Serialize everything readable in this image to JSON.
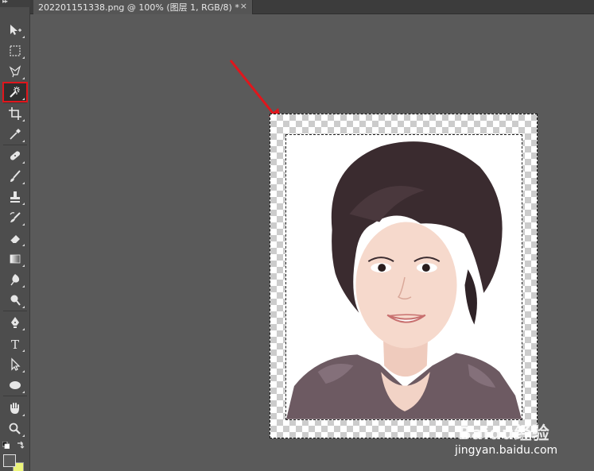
{
  "document_tab": {
    "title": "202201151338.png @ 100% (图层 1, RGB/8) *",
    "close_glyph": "×"
  },
  "toolbar": {
    "grip_glyph": "▸▸",
    "tools": [
      {
        "name": "move-tool",
        "icon": "move-icon"
      },
      {
        "name": "rect-marquee-tool",
        "icon": "rect-marquee-icon"
      },
      {
        "name": "lasso-tool",
        "icon": "lasso-icon"
      },
      {
        "name": "magic-wand-tool",
        "icon": "magic-wand-icon",
        "active": true
      },
      {
        "name": "crop-tool",
        "icon": "crop-icon"
      },
      {
        "name": "eyedropper-tool",
        "icon": "eyedropper-icon"
      },
      {
        "name": "healing-brush-tool",
        "icon": "bandage-icon"
      },
      {
        "name": "brush-tool",
        "icon": "brush-icon"
      },
      {
        "name": "clone-stamp-tool",
        "icon": "stamp-icon"
      },
      {
        "name": "history-brush-tool",
        "icon": "history-brush-icon"
      },
      {
        "name": "eraser-tool",
        "icon": "eraser-icon"
      },
      {
        "name": "gradient-tool",
        "icon": "gradient-icon"
      },
      {
        "name": "blur-tool",
        "icon": "drop-icon"
      },
      {
        "name": "dodge-tool",
        "icon": "dodge-icon"
      },
      {
        "name": "pen-tool",
        "icon": "pen-icon"
      },
      {
        "name": "type-tool",
        "icon": "type-icon",
        "label": "T"
      },
      {
        "name": "path-selection-tool",
        "icon": "arrow-icon"
      },
      {
        "name": "ellipse-tool",
        "icon": "ellipse-icon"
      },
      {
        "name": "hand-tool",
        "icon": "hand-icon"
      },
      {
        "name": "zoom-tool",
        "icon": "zoom-icon"
      }
    ],
    "foreground_color": "#5a5a5a",
    "background_color": "#ecf57a",
    "active_highlight_color": "#e0161c"
  },
  "watermark": {
    "brand": "Baidu经验",
    "url": "jingyan.baidu.com"
  },
  "annotation": {
    "arrow_color": "#e0161c"
  }
}
